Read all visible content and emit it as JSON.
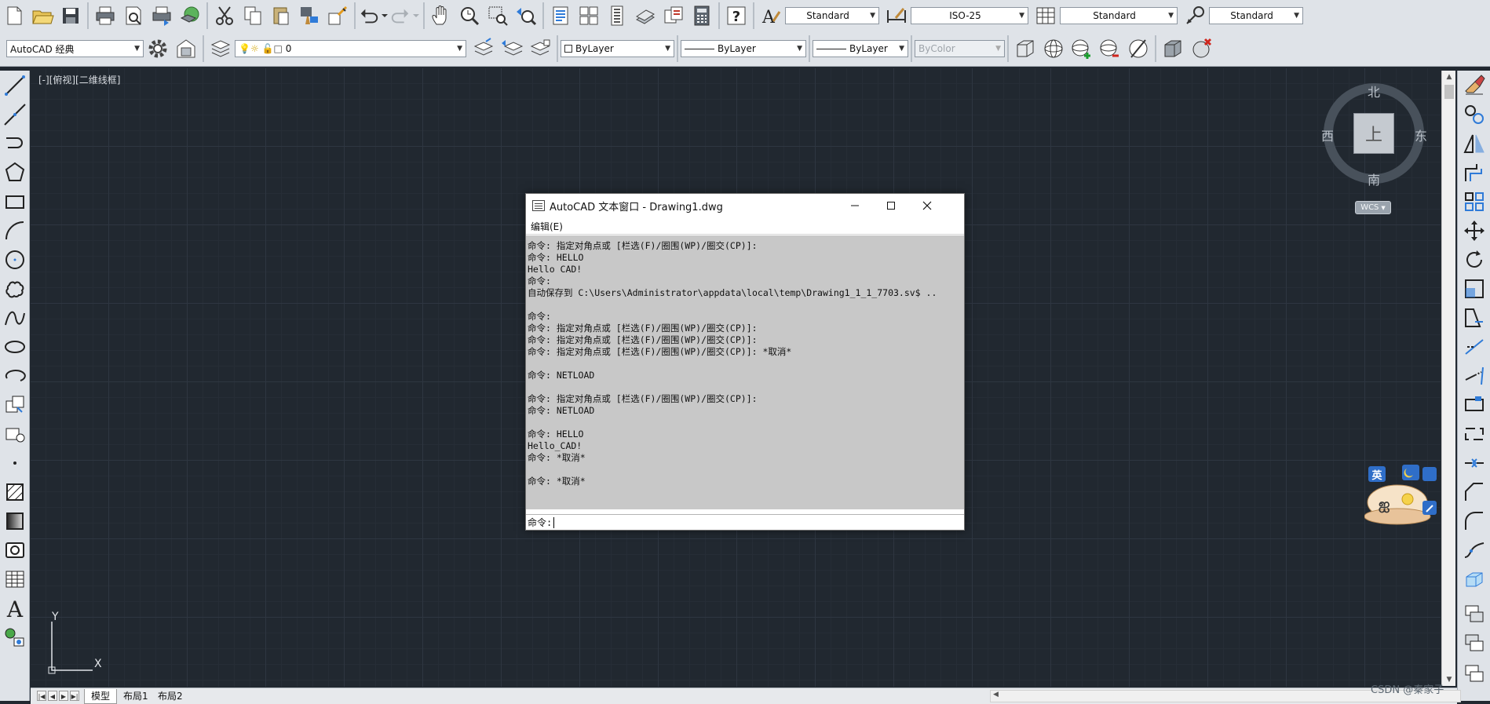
{
  "toolbar": {
    "text_style": "Standard",
    "dim_style": "ISO-25",
    "table_style": "Standard",
    "multileader_style": "Standard",
    "workspace": "AutoCAD 经典",
    "layer": "0",
    "color": "ByLayer",
    "linetype": "ByLayer",
    "lineweight": "ByLayer",
    "plot_style": "ByColor"
  },
  "viewport": {
    "label": "[-][俯视][二维线框]"
  },
  "viewcube": {
    "north": "北",
    "south": "南",
    "east": "东",
    "west": "西",
    "top_face": "上",
    "wcs": "WCS"
  },
  "ucs": {
    "x": "X",
    "y": "Y"
  },
  "mascot": {
    "lang": "英"
  },
  "text_window": {
    "title": "AutoCAD 文本窗口 - Drawing1.dwg",
    "menu_edit": "编辑(E)",
    "history": [
      "命令: 指定对角点或 [栏选(F)/圈围(WP)/圈交(CP)]:",
      "命令: HELLO",
      "Hello CAD!",
      "命令:",
      "自动保存到 C:\\Users\\Administrator\\appdata\\local\\temp\\Drawing1_1_1_7703.sv$ ..",
      "",
      "命令:",
      "命令: 指定对角点或 [栏选(F)/圈围(WP)/圈交(CP)]:",
      "命令: 指定对角点或 [栏选(F)/圈围(WP)/圈交(CP)]:",
      "命令: 指定对角点或 [栏选(F)/圈围(WP)/圈交(CP)]: *取消*",
      "",
      "命令: NETLOAD",
      "",
      "命令: 指定对角点或 [栏选(F)/圈围(WP)/圈交(CP)]:",
      "命令: NETLOAD",
      "",
      "命令: HELLO",
      "Hello_CAD!",
      "命令: *取消*",
      "",
      "命令: *取消*"
    ],
    "prompt": "命令:"
  },
  "layout_tabs": [
    "模型",
    "布局1",
    "布局2"
  ],
  "watermark": "CSDN @秦家子"
}
